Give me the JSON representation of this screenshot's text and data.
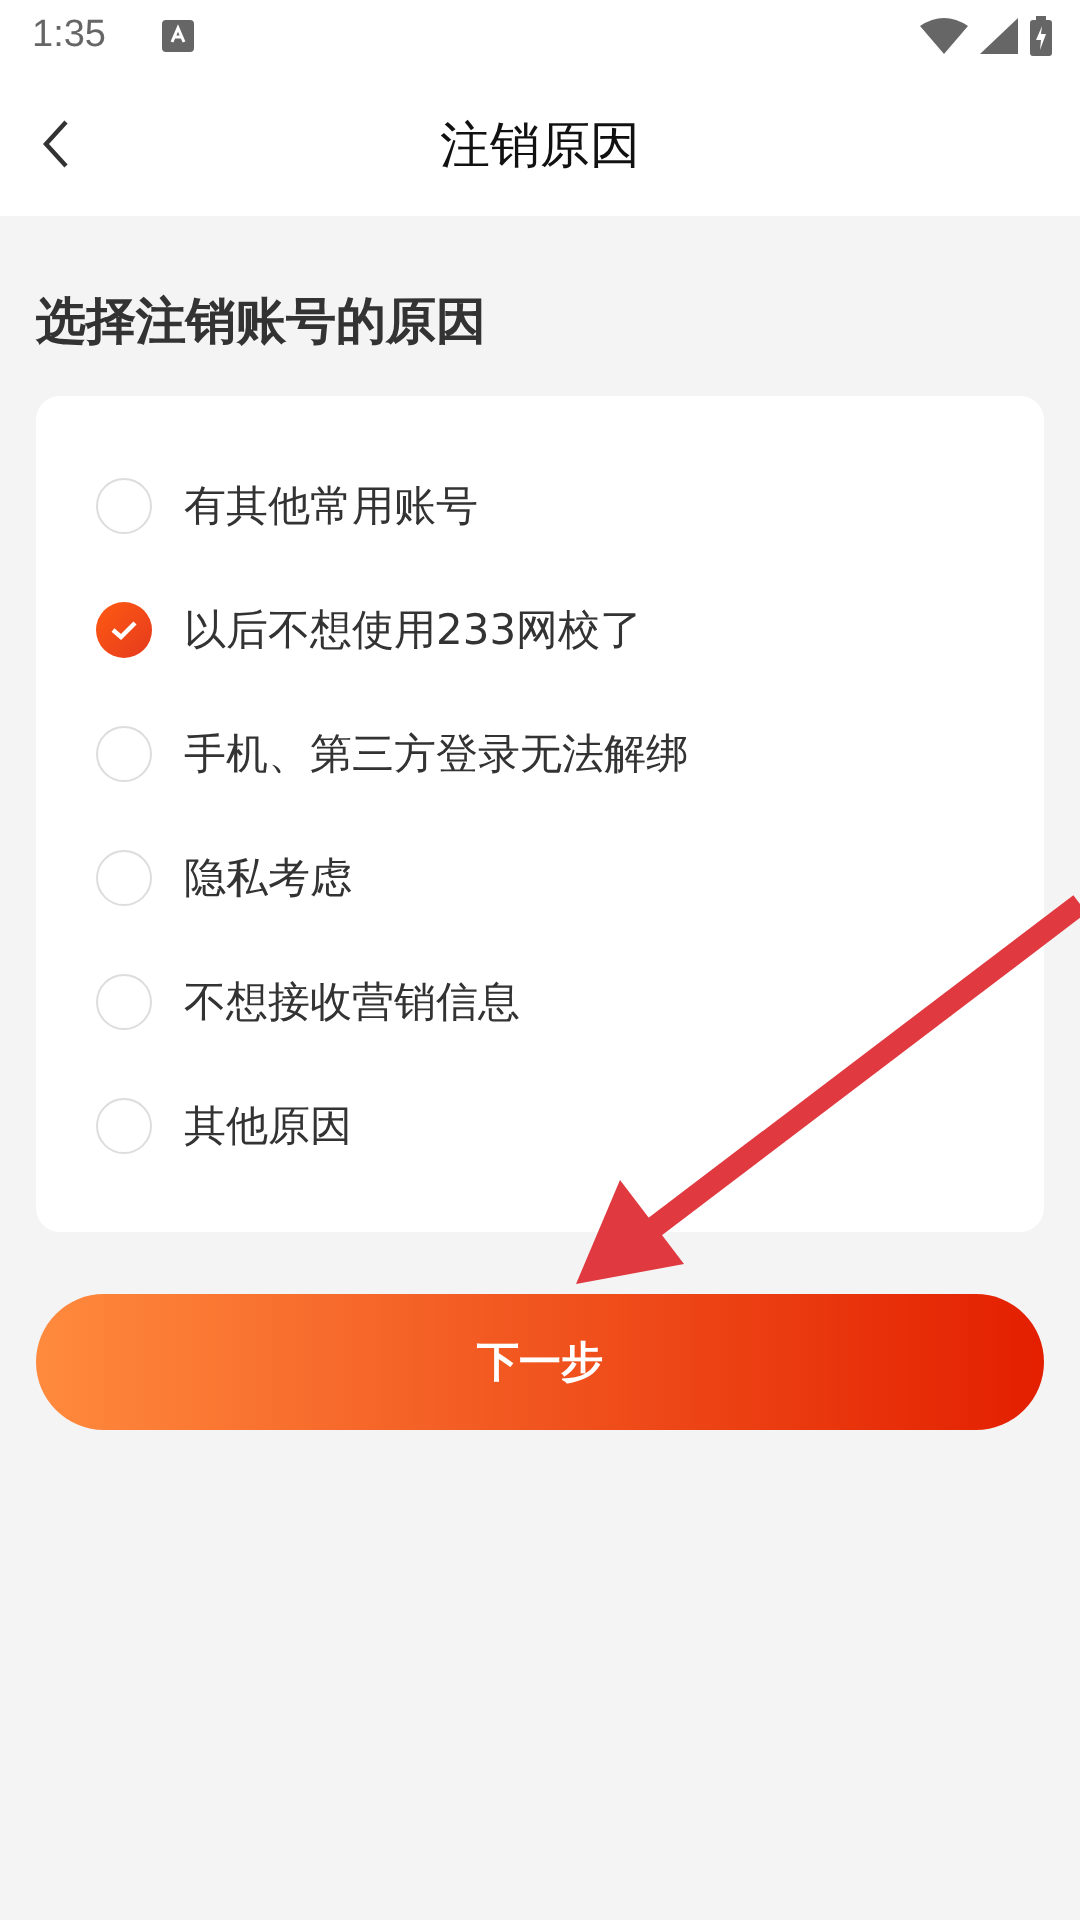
{
  "status_bar": {
    "time": "1:35"
  },
  "header": {
    "title": "注销原因"
  },
  "heading": "选择注销账号的原因",
  "reasons": [
    {
      "label": "有其他常用账号",
      "selected": false
    },
    {
      "label": "以后不想使用233网校了",
      "selected": true
    },
    {
      "label": "手机、第三方登录无法解绑",
      "selected": false
    },
    {
      "label": "隐私考虑",
      "selected": false
    },
    {
      "label": "不想接收营销信息",
      "selected": false
    },
    {
      "label": "其他原因",
      "selected": false
    }
  ],
  "next_button": "下一步"
}
